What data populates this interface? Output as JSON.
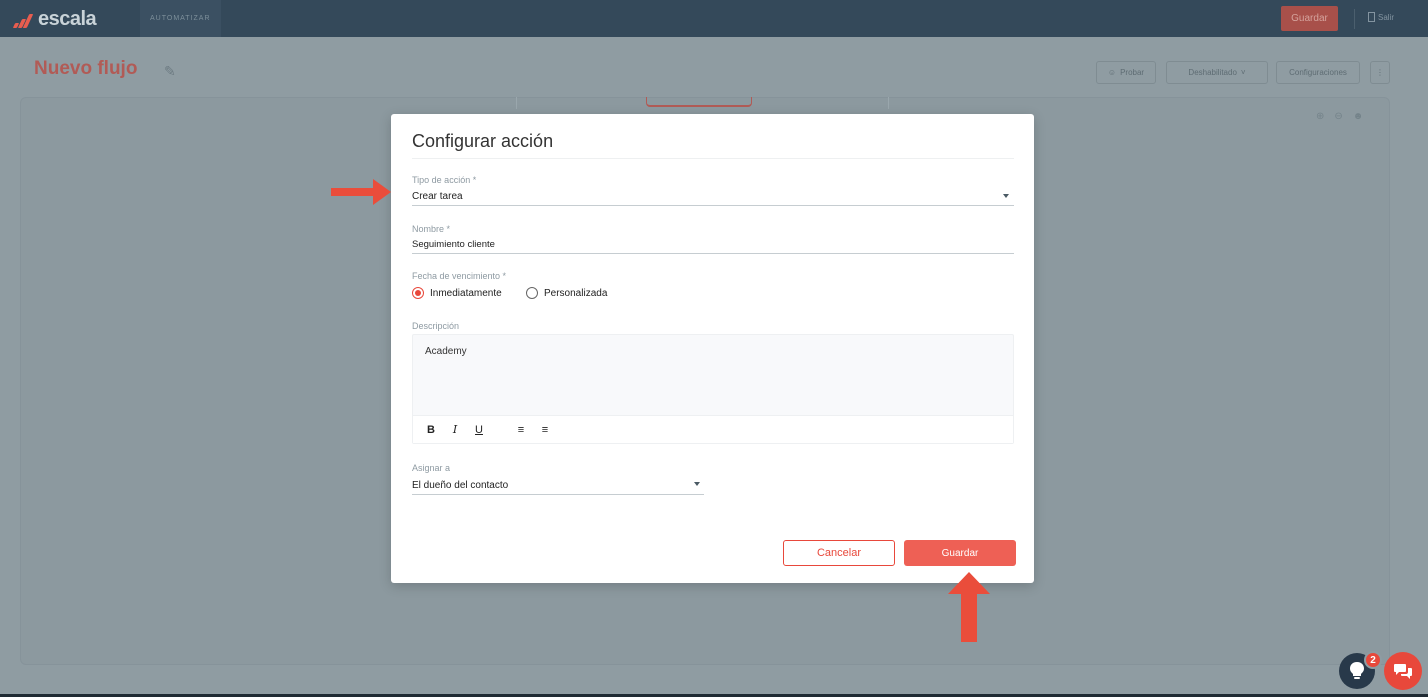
{
  "app": {
    "logo_text": "escala",
    "module": "AUTOMATIZAR",
    "top_save": "Guardar",
    "logout": "Salir"
  },
  "flow": {
    "title": "Nuevo flujo",
    "test_button": "Probar",
    "status_select": "Deshabilitado",
    "settings_button": "Configuraciones"
  },
  "modal": {
    "title": "Configurar acción",
    "action_type": {
      "label": "Tipo de acción *",
      "value": "Crear tarea"
    },
    "name": {
      "label": "Nombre *",
      "value": "Seguimiento cliente"
    },
    "due_date": {
      "label": "Fecha de vencimiento *",
      "options": [
        {
          "label": "Inmediatamente",
          "checked": true
        },
        {
          "label": "Personalizada",
          "checked": false
        }
      ]
    },
    "description": {
      "label": "Descripción",
      "value": "Academy",
      "toolbar": [
        "bold-icon",
        "italic-icon",
        "underline-icon",
        "ordered-list-icon",
        "bullet-list-icon"
      ]
    },
    "assign_to": {
      "label": "Asignar a",
      "value": "El dueño del contacto"
    },
    "cancel_label": "Cancelar",
    "save_label": "Guardar"
  },
  "widgets": {
    "notification_count": "2"
  },
  "colors": {
    "accent": "#ee6055",
    "accent_dark": "#e8483b",
    "topbar": "#34495a",
    "overlay_bg": "#8f9ca2"
  }
}
